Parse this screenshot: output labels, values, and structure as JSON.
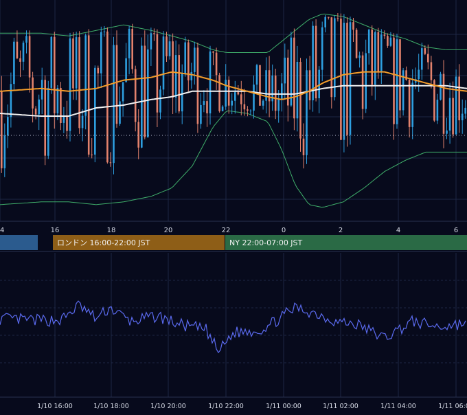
{
  "colors": {
    "background": "#070a1c",
    "grid": "#1e2744",
    "candle_up": "#2e9fe0",
    "candle_down": "#e3826d",
    "sma_short": "#f39c2a",
    "sma_long": "#f2f2f2",
    "bollinger": "#3fae6a",
    "oscillator": "#5b6bf0",
    "axis_text": "#d7dbe6",
    "divider": "#2a3150",
    "tokyo": "#2b5b8e",
    "london": "#8e5e17",
    "ny": "#2a6a45"
  },
  "chart_data": [
    {
      "type": "candlestick",
      "x_ticks": [
        "4",
        "16",
        "18",
        "20",
        "22",
        "0",
        "2",
        "4",
        "6"
      ],
      "sessions": [
        {
          "name": "tokyo",
          "label": ""
        },
        {
          "name": "london",
          "label": "ロンドン 16:00-22:00 JST"
        },
        {
          "name": "ny",
          "label": "NY 22:00-07:00 JST"
        }
      ],
      "overlays": [
        "sma_short",
        "sma_long",
        "bollinger_upper",
        "bollinger_lower",
        "reference_dotted_line"
      ],
      "key_points": [
        {
          "x": 0,
          "ma_short": 0.77,
          "ma_long": 0.69,
          "bb_upper": 0.98,
          "bb_lower": 0.36
        },
        {
          "x": 60,
          "ma_short": 0.78,
          "ma_long": 0.68,
          "bb_upper": 0.98,
          "bb_lower": 0.37
        },
        {
          "x": 100,
          "ma_short": 0.77,
          "ma_long": 0.68,
          "bb_upper": 0.97,
          "bb_lower": 0.37
        },
        {
          "x": 140,
          "ma_short": 0.78,
          "ma_long": 0.71,
          "bb_upper": 0.99,
          "bb_lower": 0.36
        },
        {
          "x": 180,
          "ma_short": 0.81,
          "ma_long": 0.72,
          "bb_upper": 1.01,
          "bb_lower": 0.37
        },
        {
          "x": 220,
          "ma_short": 0.82,
          "ma_long": 0.74,
          "bb_upper": 0.99,
          "bb_lower": 0.39
        },
        {
          "x": 250,
          "ma_short": 0.84,
          "ma_long": 0.75,
          "bb_upper": 0.97,
          "bb_lower": 0.42
        },
        {
          "x": 280,
          "ma_short": 0.83,
          "ma_long": 0.77,
          "bb_upper": 0.95,
          "bb_lower": 0.5
        },
        {
          "x": 310,
          "ma_short": 0.81,
          "ma_long": 0.77,
          "bb_upper": 0.92,
          "bb_lower": 0.64
        },
        {
          "x": 330,
          "ma_short": 0.79,
          "ma_long": 0.77,
          "bb_upper": 0.91,
          "bb_lower": 0.7
        },
        {
          "x": 360,
          "ma_short": 0.77,
          "ma_long": 0.77,
          "bb_upper": 0.91,
          "bb_lower": 0.69
        },
        {
          "x": 390,
          "ma_short": 0.75,
          "ma_long": 0.76,
          "bb_upper": 0.91,
          "bb_lower": 0.66
        },
        {
          "x": 410,
          "ma_short": 0.74,
          "ma_long": 0.76,
          "bb_upper": 0.95,
          "bb_lower": 0.56
        },
        {
          "x": 430,
          "ma_short": 0.75,
          "ma_long": 0.76,
          "bb_upper": 0.99,
          "bb_lower": 0.43
        },
        {
          "x": 450,
          "ma_short": 0.77,
          "ma_long": 0.77,
          "bb_upper": 1.03,
          "bb_lower": 0.36
        },
        {
          "x": 470,
          "ma_short": 0.8,
          "ma_long": 0.78,
          "bb_upper": 1.05,
          "bb_lower": 0.35
        },
        {
          "x": 500,
          "ma_short": 0.83,
          "ma_long": 0.79,
          "bb_upper": 1.04,
          "bb_lower": 0.37
        },
        {
          "x": 530,
          "ma_short": 0.84,
          "ma_long": 0.79,
          "bb_upper": 1.01,
          "bb_lower": 0.42
        },
        {
          "x": 560,
          "ma_short": 0.84,
          "ma_long": 0.79,
          "bb_upper": 0.98,
          "bb_lower": 0.48
        },
        {
          "x": 590,
          "ma_short": 0.82,
          "ma_long": 0.79,
          "bb_upper": 0.96,
          "bb_lower": 0.52
        },
        {
          "x": 620,
          "ma_short": 0.8,
          "ma_long": 0.79,
          "bb_upper": 0.93,
          "bb_lower": 0.55
        },
        {
          "x": 650,
          "ma_short": 0.78,
          "ma_long": 0.79,
          "bb_upper": 0.92,
          "bb_lower": 0.55
        },
        {
          "x": 680,
          "ma_short": 0.77,
          "ma_long": 0.78,
          "bb_upper": 0.92,
          "bb_lower": 0.55
        }
      ],
      "candle_count": 150,
      "wick_range": 0.06
    },
    {
      "type": "line",
      "name": "oscillator",
      "x_ticks": [
        "1/10 16:00",
        "1/10 18:00",
        "1/10 20:00",
        "1/10 22:00",
        "1/11 00:00",
        "1/11 02:00",
        "1/11 04:00",
        "1/11 06:00"
      ],
      "key_points": [
        {
          "x": 0,
          "v": 0.05
        },
        {
          "x": 60,
          "v": 0.02
        },
        {
          "x": 90,
          "v": 0.03
        },
        {
          "x": 115,
          "v": 0.3
        },
        {
          "x": 140,
          "v": 0.05
        },
        {
          "x": 160,
          "v": 0.25
        },
        {
          "x": 190,
          "v": 0.0
        },
        {
          "x": 230,
          "v": 0.1
        },
        {
          "x": 260,
          "v": -0.05
        },
        {
          "x": 300,
          "v": -0.15
        },
        {
          "x": 318,
          "v": -0.55
        },
        {
          "x": 340,
          "v": -0.2
        },
        {
          "x": 380,
          "v": -0.15
        },
        {
          "x": 400,
          "v": 0.0
        },
        {
          "x": 430,
          "v": 0.25
        },
        {
          "x": 460,
          "v": 0.15
        },
        {
          "x": 490,
          "v": 0.0
        },
        {
          "x": 520,
          "v": -0.05
        },
        {
          "x": 560,
          "v": -0.3
        },
        {
          "x": 600,
          "v": 0.0
        },
        {
          "x": 640,
          "v": -0.1
        },
        {
          "x": 680,
          "v": -0.02
        }
      ]
    }
  ]
}
